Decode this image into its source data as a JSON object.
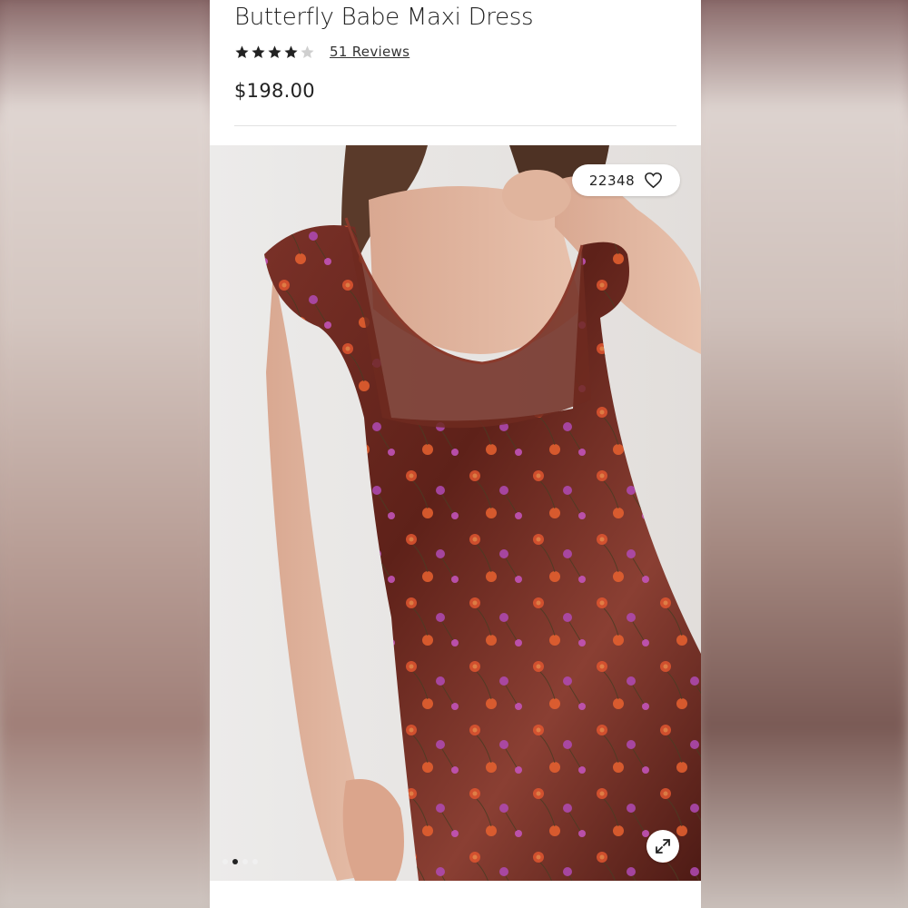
{
  "product": {
    "title": "Butterfly Babe Maxi Dress",
    "rating": 4,
    "rating_max": 5,
    "reviews_label": "51 Reviews",
    "price": "$198.00"
  },
  "gallery": {
    "like_count": "22348",
    "current_image_index": 2,
    "image_count": 4
  },
  "icons": {
    "star": "star-icon",
    "heart": "heart-icon",
    "expand": "expand-icon"
  },
  "colors": {
    "text": "#222222",
    "star_filled": "#222222",
    "star_empty": "#cccccc",
    "dress": "#6b2a22"
  }
}
